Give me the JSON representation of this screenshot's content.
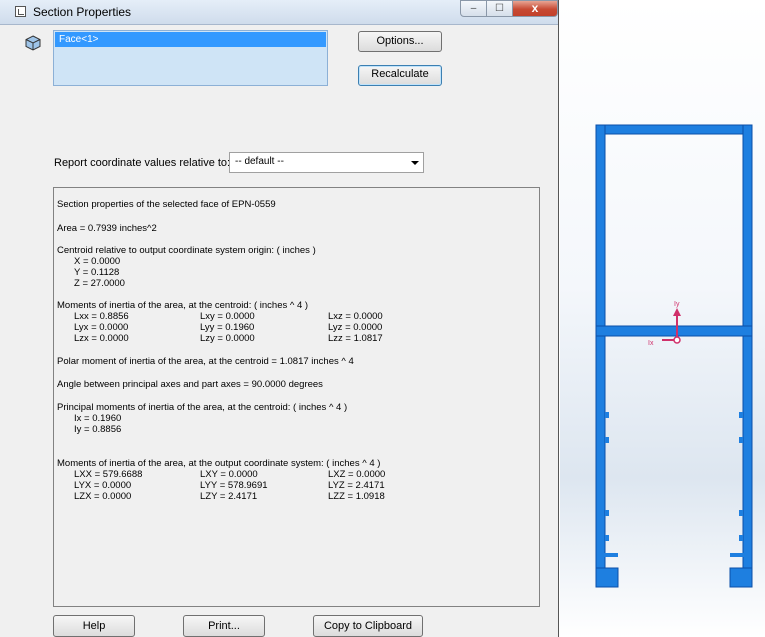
{
  "window": {
    "title": "Section Properties",
    "min_glyph": "–",
    "max_glyph": "☐",
    "close_glyph": "x"
  },
  "selection": {
    "items": [
      "Face<1>"
    ]
  },
  "buttons": {
    "options": "Options...",
    "recalculate": "Recalculate",
    "help": "Help",
    "print": "Print...",
    "copy": "Copy to Clipboard"
  },
  "coordinate": {
    "label": "Report coordinate values relative to:",
    "selected": "-- default --"
  },
  "results": {
    "header": "Section properties of the selected face of EPN-0559",
    "area": "Area = 0.7939 inches^2",
    "centroid_title": "Centroid relative to output coordinate system origin: ( inches )",
    "centroid_x": "X = 0.0000",
    "centroid_y": "Y = 0.1128",
    "centroid_z": "Z = 27.0000",
    "moments_centroid_title": "Moments of inertia of the area, at the centroid: ( inches ^ 4 )",
    "moments_centroid": [
      [
        "Lxx = 0.8856",
        "Lxy = 0.0000",
        "Lxz = 0.0000"
      ],
      [
        "Lyx = 0.0000",
        "Lyy = 0.1960",
        "Lyz = 0.0000"
      ],
      [
        "Lzx = 0.0000",
        "Lzy = 0.0000",
        "Lzz = 1.0817"
      ]
    ],
    "polar": "Polar moment of inertia of the area, at the centroid = 1.0817 inches ^ 4",
    "angle": "Angle between principal axes and part axes = 90.0000 degrees",
    "principal_title": "Principal moments of inertia of the area, at the centroid: ( inches ^ 4 )",
    "principal_ix": "Ix = 0.1960",
    "principal_iy": "Iy = 0.8856",
    "moments_output_title": "Moments of inertia of the area, at the output coordinate system: ( inches ^ 4 )",
    "moments_output": [
      [
        "LXX = 579.6688",
        "LXY = 0.0000",
        "LXZ = 0.0000"
      ],
      [
        "LYX = 0.0000",
        "LYY = 578.9691",
        "LYZ = 2.4171"
      ],
      [
        "LZX = 0.0000",
        "LZY = 2.4171",
        "LZZ = 1.0918"
      ]
    ]
  },
  "viewport": {
    "axis_labels": {
      "y": "Iy",
      "x": "Ix"
    },
    "colors": {
      "profile": "#1e7fe0",
      "profile_dark": "#0b4fa8",
      "axis": "#d0306a"
    }
  },
  "icons": {
    "part": "part-cube-icon",
    "title": "section-properties-icon",
    "dropdown": "chevron-down-icon"
  }
}
